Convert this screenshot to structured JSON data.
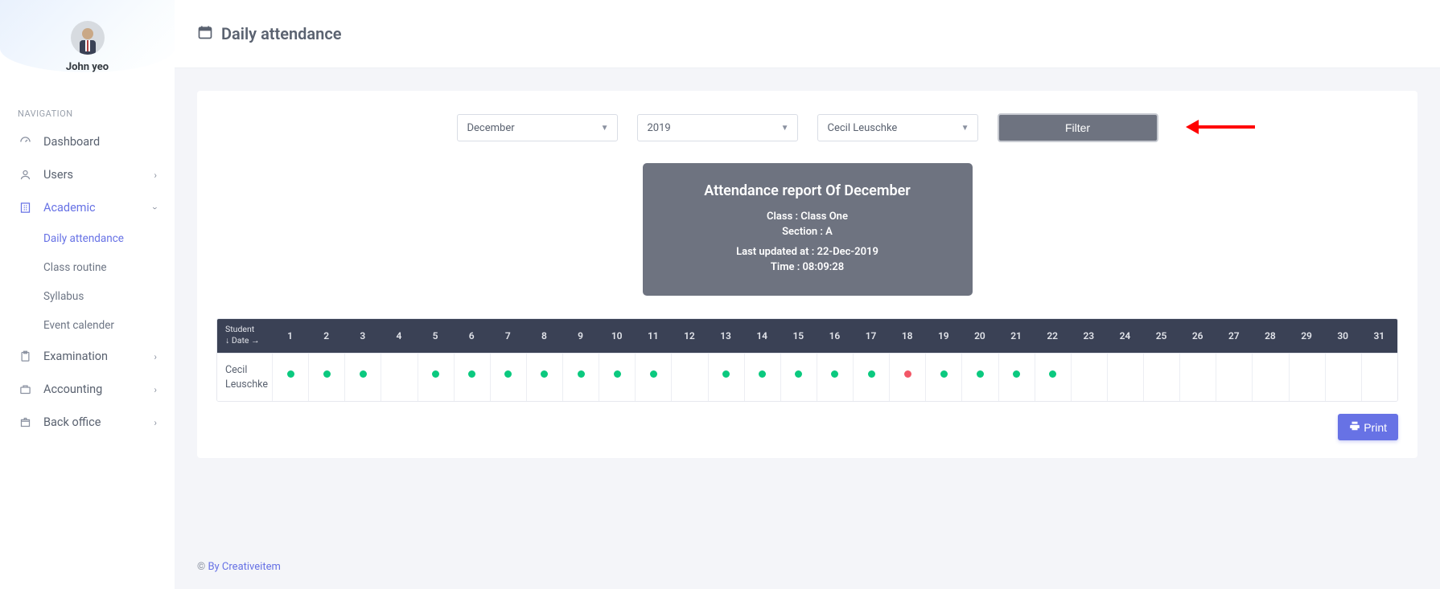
{
  "user": {
    "name": "John yeo"
  },
  "sidebar": {
    "section_label": "NAVIGATION",
    "items": [
      {
        "label": "Dashboard",
        "icon": "dashboard"
      },
      {
        "label": "Users",
        "icon": "user",
        "expandable": true
      },
      {
        "label": "Academic",
        "icon": "building",
        "expandable": true,
        "active": true
      },
      {
        "label": "Examination",
        "icon": "clipboard",
        "expandable": true
      },
      {
        "label": "Accounting",
        "icon": "briefcase",
        "expandable": true
      },
      {
        "label": "Back office",
        "icon": "box",
        "expandable": true
      }
    ],
    "academic_sub": [
      {
        "label": "Daily attendance",
        "active": true
      },
      {
        "label": "Class routine"
      },
      {
        "label": "Syllabus"
      },
      {
        "label": "Event calender"
      }
    ]
  },
  "header": {
    "title": "Daily attendance"
  },
  "filters": {
    "month": "December",
    "year": "2019",
    "student": "Cecil Leuschke",
    "button": "Filter"
  },
  "report": {
    "title": "Attendance report Of December",
    "class_line": "Class : Class One",
    "section_line": "Section : A",
    "updated_line": "Last updated at : 22-Dec-2019",
    "time_line": "Time : 08:09:28"
  },
  "table": {
    "student_header": "Student\n↓ Date →",
    "days": [
      "1",
      "2",
      "3",
      "4",
      "5",
      "6",
      "7",
      "8",
      "9",
      "10",
      "11",
      "12",
      "13",
      "14",
      "15",
      "16",
      "17",
      "18",
      "19",
      "20",
      "21",
      "22",
      "23",
      "24",
      "25",
      "26",
      "27",
      "28",
      "29",
      "30",
      "31"
    ],
    "row": {
      "student": "Cecil Leuschke",
      "cells": [
        "present",
        "present",
        "present",
        "",
        "present",
        "present",
        "present",
        "present",
        "present",
        "present",
        "present",
        "",
        "present",
        "present",
        "present",
        "present",
        "present",
        "absent",
        "present",
        "present",
        "present",
        "present",
        "",
        "",
        "",
        "",
        "",
        "",
        "",
        "",
        ""
      ]
    }
  },
  "buttons": {
    "print": "Print"
  },
  "footer": {
    "prefix": "© ",
    "link": "By Creativeitem"
  }
}
